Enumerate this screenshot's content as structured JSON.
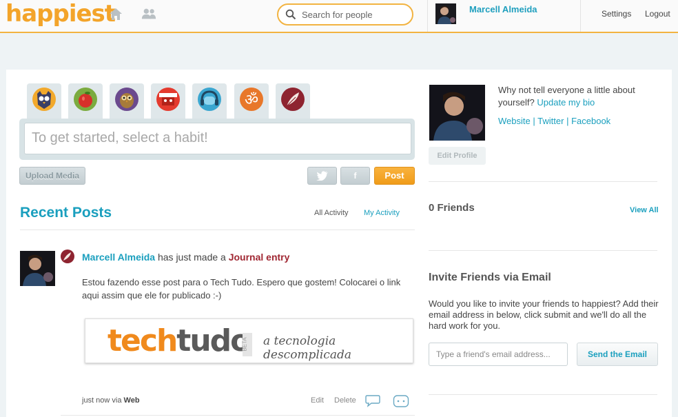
{
  "header": {
    "logo": "happiest",
    "search_placeholder": "Search for people",
    "user_name": "Marcell Almeida",
    "settings_label": "Settings",
    "logout_label": "Logout",
    "accent_color": "#f2b340"
  },
  "composer": {
    "habits": [
      "owl-mask-icon",
      "apple-icon",
      "owl-icon",
      "ninja-icon",
      "headphones-icon",
      "om-icon",
      "feather-icon"
    ],
    "placeholder": "To get started, select a habit!",
    "upload_label": "Upload Media",
    "twitter_icon": "t",
    "facebook_icon": "f",
    "post_label": "Post"
  },
  "feed": {
    "title": "Recent Posts",
    "tab_all": "All Activity",
    "tab_mine": "My Activity",
    "post": {
      "author": "Marcell Almeida",
      "action": "has just made a",
      "type": "Journal entry",
      "body": "Estou fazendo esse post para o Tech Tudo. Espero que gostem! Colocarei o link aqui assim que ele for publicado :-)",
      "media_brand_orange": "tech",
      "media_brand_grey": "tudo",
      "media_beta": "BETA",
      "media_tagline": "a tecnologia descomplicada",
      "time": "just now via",
      "source": "Web",
      "edit_label": "Edit",
      "delete_label": "Delete"
    }
  },
  "profile": {
    "bio_prompt": "Why not tell everyone a little about yourself?",
    "bio_link": "Update my bio",
    "website": "Website",
    "twitter": "Twitter",
    "facebook": "Facebook",
    "separator": "|",
    "edit_label": "Edit Profile"
  },
  "friends": {
    "title": "0 Friends",
    "view_all": "View All"
  },
  "invite": {
    "title": "Invite Friends via Email",
    "text": "Would you like to invite your friends to happiest? Add their email address in below, click submit and we'll do all the hard work for you.",
    "placeholder": "Type a friend's email address...",
    "send_label": "Send the Email"
  }
}
